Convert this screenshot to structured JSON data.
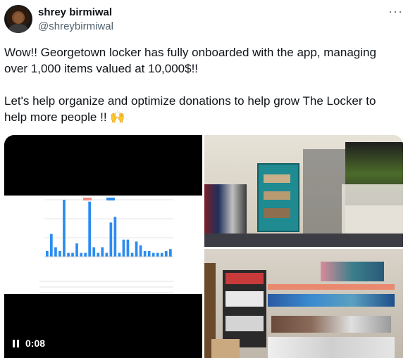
{
  "author": {
    "name": "shrey birmiwal",
    "handle": "@shreybirmiwal"
  },
  "more_glyph": "···",
  "tweet": {
    "line1": "Wow!! Georgetown locker has fully onboarded with the app, managing over 1,000 items valued at 10,000$!!",
    "line2": "Let's help organize and optimize donations to help grow The Locker to help more people !! 🙌"
  },
  "video": {
    "time": "0:08",
    "chart_data": {
      "type": "bar",
      "values": [
        3,
        12,
        5,
        3,
        30,
        2,
        2,
        7,
        2,
        2,
        29,
        5,
        2,
        5,
        2,
        18,
        21,
        2,
        9,
        9,
        2,
        8,
        6,
        3,
        3,
        2,
        2,
        2,
        3,
        4
      ]
    }
  },
  "colors": {
    "bar": "#2b8cf0",
    "handle": "#536471"
  }
}
